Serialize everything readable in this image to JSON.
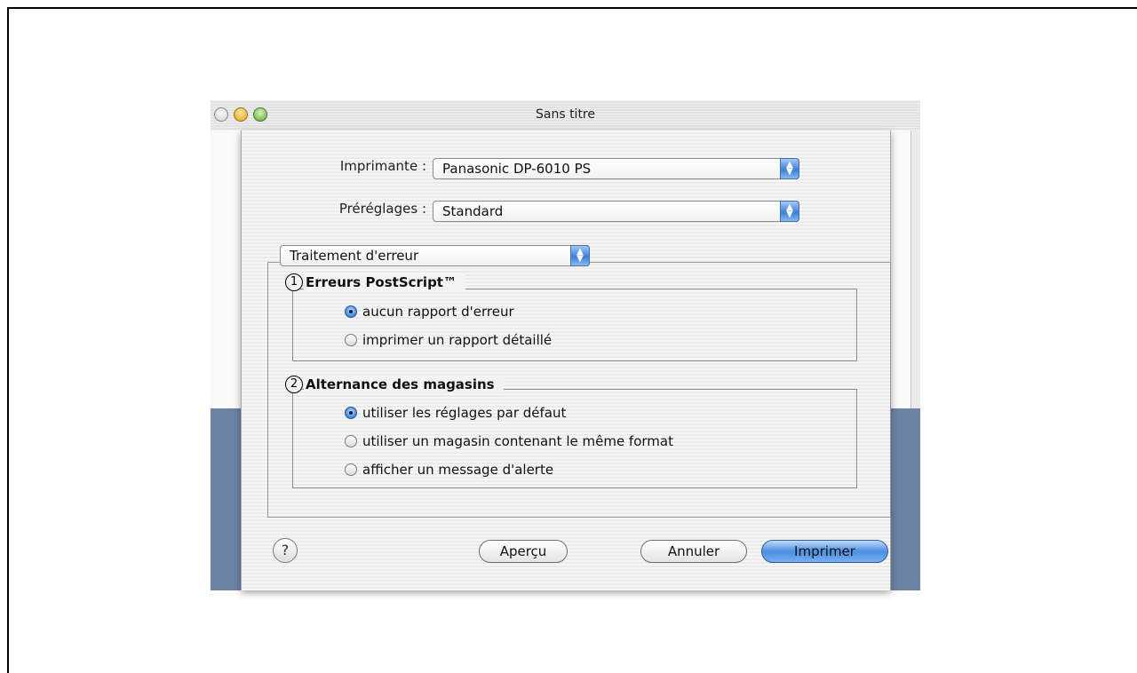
{
  "window": {
    "title": "Sans titre"
  },
  "printer": {
    "label": "Imprimante :",
    "value": "Panasonic DP-6010 PS"
  },
  "presets": {
    "label": "Préréglages :",
    "value": "Standard"
  },
  "panel": {
    "value": "Traitement d'erreur"
  },
  "section1": {
    "number": "1",
    "title": "Erreurs PostScript™",
    "options": [
      {
        "label": "aucun rapport d'erreur",
        "selected": true
      },
      {
        "label": "imprimer un rapport détaillé",
        "selected": false
      }
    ]
  },
  "section2": {
    "number": "2",
    "title": "Alternance des magasins",
    "options": [
      {
        "label": "utiliser les réglages par défaut",
        "selected": true
      },
      {
        "label": "utiliser un magasin contenant le même format",
        "selected": false
      },
      {
        "label": "afficher un message d'alerte",
        "selected": false
      }
    ]
  },
  "buttons": {
    "help": "?",
    "preview": "Aperçu",
    "cancel": "Annuler",
    "print": "Imprimer"
  },
  "colors": {
    "accent": "#4c8fe2",
    "desktop": "#6d83a6"
  }
}
